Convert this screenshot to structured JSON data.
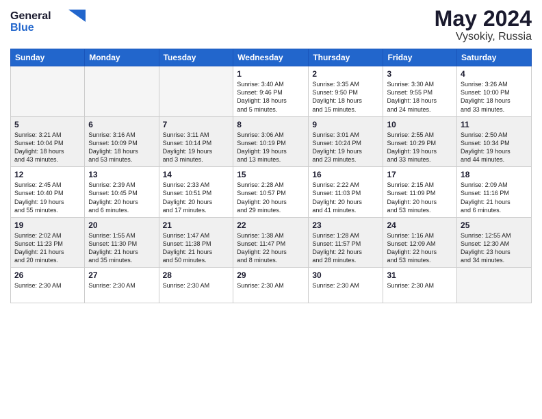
{
  "logo": {
    "line1": "General",
    "line2": "Blue"
  },
  "title": "May 2024",
  "location": "Vysokiy, Russia",
  "days_header": [
    "Sunday",
    "Monday",
    "Tuesday",
    "Wednesday",
    "Thursday",
    "Friday",
    "Saturday"
  ],
  "weeks": [
    {
      "alt": false,
      "days": [
        {
          "num": "",
          "info": ""
        },
        {
          "num": "",
          "info": ""
        },
        {
          "num": "",
          "info": ""
        },
        {
          "num": "1",
          "info": "Sunrise: 3:40 AM\nSunset: 9:46 PM\nDaylight: 18 hours\nand 5 minutes."
        },
        {
          "num": "2",
          "info": "Sunrise: 3:35 AM\nSunset: 9:50 PM\nDaylight: 18 hours\nand 15 minutes."
        },
        {
          "num": "3",
          "info": "Sunrise: 3:30 AM\nSunset: 9:55 PM\nDaylight: 18 hours\nand 24 minutes."
        },
        {
          "num": "4",
          "info": "Sunrise: 3:26 AM\nSunset: 10:00 PM\nDaylight: 18 hours\nand 33 minutes."
        }
      ]
    },
    {
      "alt": true,
      "days": [
        {
          "num": "5",
          "info": "Sunrise: 3:21 AM\nSunset: 10:04 PM\nDaylight: 18 hours\nand 43 minutes."
        },
        {
          "num": "6",
          "info": "Sunrise: 3:16 AM\nSunset: 10:09 PM\nDaylight: 18 hours\nand 53 minutes."
        },
        {
          "num": "7",
          "info": "Sunrise: 3:11 AM\nSunset: 10:14 PM\nDaylight: 19 hours\nand 3 minutes."
        },
        {
          "num": "8",
          "info": "Sunrise: 3:06 AM\nSunset: 10:19 PM\nDaylight: 19 hours\nand 13 minutes."
        },
        {
          "num": "9",
          "info": "Sunrise: 3:01 AM\nSunset: 10:24 PM\nDaylight: 19 hours\nand 23 minutes."
        },
        {
          "num": "10",
          "info": "Sunrise: 2:55 AM\nSunset: 10:29 PM\nDaylight: 19 hours\nand 33 minutes."
        },
        {
          "num": "11",
          "info": "Sunrise: 2:50 AM\nSunset: 10:34 PM\nDaylight: 19 hours\nand 44 minutes."
        }
      ]
    },
    {
      "alt": false,
      "days": [
        {
          "num": "12",
          "info": "Sunrise: 2:45 AM\nSunset: 10:40 PM\nDaylight: 19 hours\nand 55 minutes."
        },
        {
          "num": "13",
          "info": "Sunrise: 2:39 AM\nSunset: 10:45 PM\nDaylight: 20 hours\nand 6 minutes."
        },
        {
          "num": "14",
          "info": "Sunrise: 2:33 AM\nSunset: 10:51 PM\nDaylight: 20 hours\nand 17 minutes."
        },
        {
          "num": "15",
          "info": "Sunrise: 2:28 AM\nSunset: 10:57 PM\nDaylight: 20 hours\nand 29 minutes."
        },
        {
          "num": "16",
          "info": "Sunrise: 2:22 AM\nSunset: 11:03 PM\nDaylight: 20 hours\nand 41 minutes."
        },
        {
          "num": "17",
          "info": "Sunrise: 2:15 AM\nSunset: 11:09 PM\nDaylight: 20 hours\nand 53 minutes."
        },
        {
          "num": "18",
          "info": "Sunrise: 2:09 AM\nSunset: 11:16 PM\nDaylight: 21 hours\nand 6 minutes."
        }
      ]
    },
    {
      "alt": true,
      "days": [
        {
          "num": "19",
          "info": "Sunrise: 2:02 AM\nSunset: 11:23 PM\nDaylight: 21 hours\nand 20 minutes."
        },
        {
          "num": "20",
          "info": "Sunrise: 1:55 AM\nSunset: 11:30 PM\nDaylight: 21 hours\nand 35 minutes."
        },
        {
          "num": "21",
          "info": "Sunrise: 1:47 AM\nSunset: 11:38 PM\nDaylight: 21 hours\nand 50 minutes."
        },
        {
          "num": "22",
          "info": "Sunrise: 1:38 AM\nSunset: 11:47 PM\nDaylight: 22 hours\nand 8 minutes."
        },
        {
          "num": "23",
          "info": "Sunrise: 1:28 AM\nSunset: 11:57 PM\nDaylight: 22 hours\nand 28 minutes."
        },
        {
          "num": "24",
          "info": "Sunrise: 1:16 AM\nSunset: 12:09 AM\nDaylight: 22 hours\nand 53 minutes."
        },
        {
          "num": "25",
          "info": "Sunrise: 12:55 AM\nSunset: 12:30 AM\nDaylight: 23 hours\nand 34 minutes."
        }
      ]
    },
    {
      "alt": false,
      "last": true,
      "days": [
        {
          "num": "26",
          "info": "Sunrise: 2:30 AM"
        },
        {
          "num": "27",
          "info": "Sunrise: 2:30 AM"
        },
        {
          "num": "28",
          "info": "Sunrise: 2:30 AM"
        },
        {
          "num": "29",
          "info": "Sunrise: 2:30 AM"
        },
        {
          "num": "30",
          "info": "Sunrise: 2:30 AM"
        },
        {
          "num": "31",
          "info": "Sunrise: 2:30 AM"
        },
        {
          "num": "",
          "info": ""
        }
      ]
    }
  ]
}
